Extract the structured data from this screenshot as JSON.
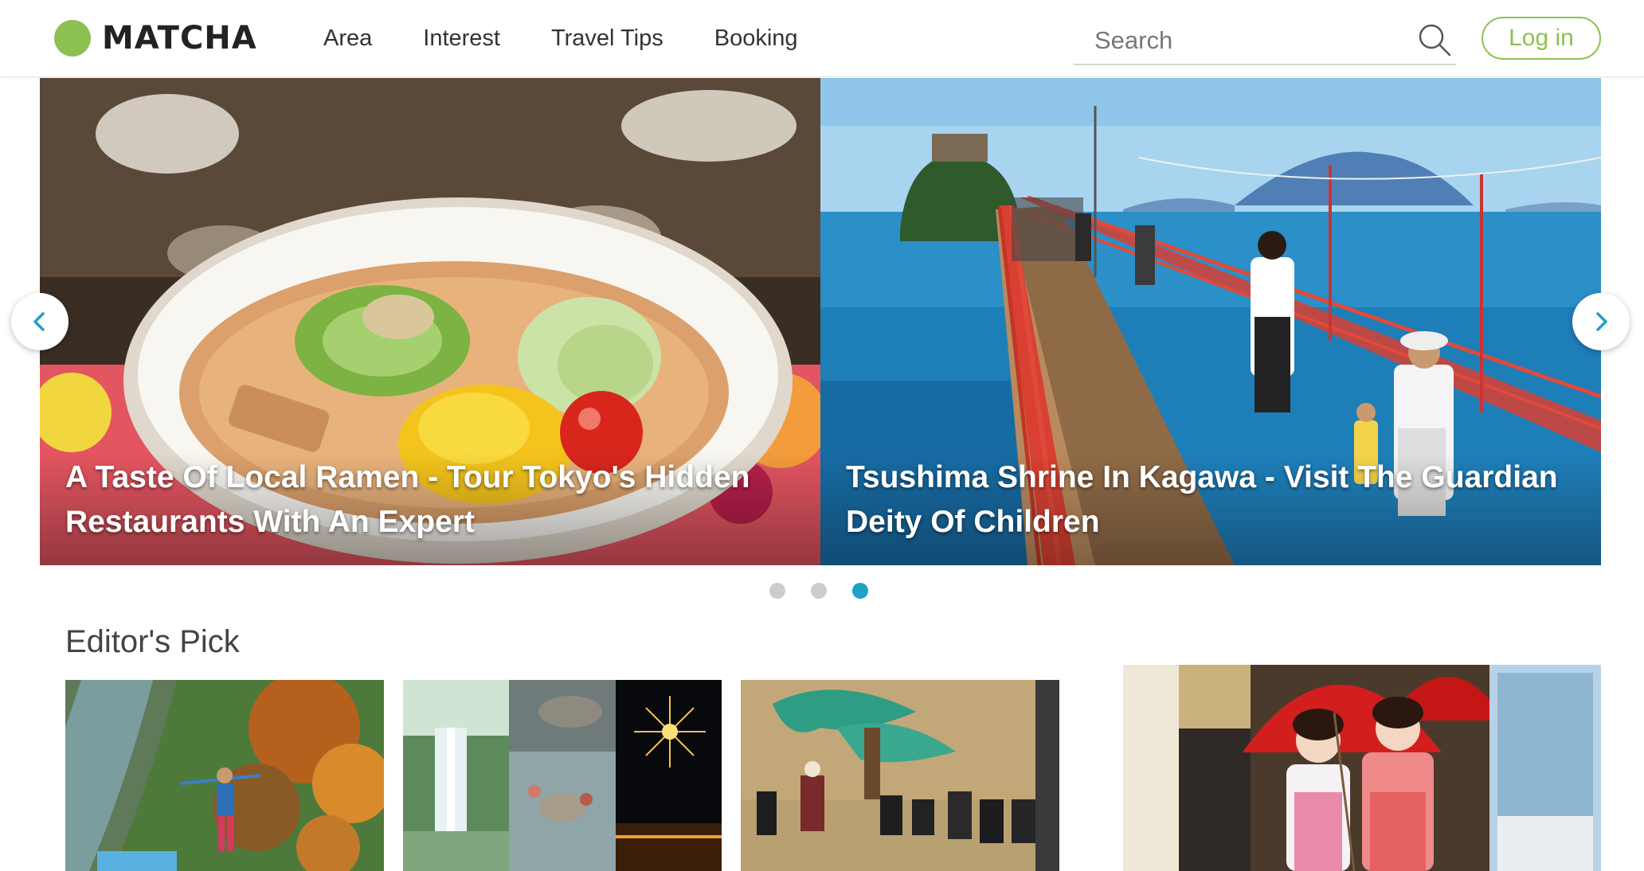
{
  "brand": {
    "name": "MATCHA",
    "color": "#8cc152"
  },
  "nav": {
    "items": [
      "Area",
      "Interest",
      "Travel Tips",
      "Booking"
    ]
  },
  "search": {
    "placeholder": "Search"
  },
  "auth": {
    "login_label": "Log in"
  },
  "carousel": {
    "slides": [
      {
        "title": "A Taste Of Local Ramen - Tour Tokyo's Hidden Restaurants With An Expert"
      },
      {
        "title": "Tsushima Shrine In Kagawa - Visit The Guardian Deity Of Children"
      }
    ],
    "dots": 3,
    "active_dot": 3,
    "active_color": "#1ea2c6"
  },
  "editors_pick": {
    "title": "Editor's Pick"
  }
}
